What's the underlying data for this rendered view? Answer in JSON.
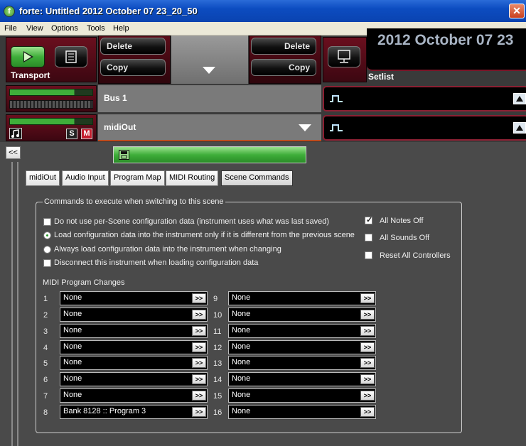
{
  "window": {
    "title": "forte: Untitled 2012 October 07 23_20_50",
    "close_glyph": "✕",
    "app_icon_letter": "f"
  },
  "menu": [
    {
      "label": "File",
      "name": "menu-file"
    },
    {
      "label": "View",
      "name": "menu-view"
    },
    {
      "label": "Options",
      "name": "menu-options"
    },
    {
      "label": "Tools",
      "name": "menu-tools"
    },
    {
      "label": "Help",
      "name": "menu-help"
    }
  ],
  "transport": {
    "label": "Transport"
  },
  "scene_buttons": {
    "delete_left": "Delete",
    "copy_left": "Copy",
    "delete_right": "Delete",
    "copy_right": "Copy"
  },
  "setlist": {
    "label": "Setlist",
    "banner": "2012 October 07 23"
  },
  "bus": {
    "name": "Bus 1"
  },
  "instrument": {
    "name": "midiOut",
    "solo": "S",
    "mute": "M"
  },
  "collapse": {
    "label": "<<"
  },
  "tabs": [
    "midiOut",
    "Audio Input",
    "Program Map",
    "MIDI Routing",
    "Scene Commands"
  ],
  "commands": {
    "group_title": "Commands to execute when switching to this scene",
    "options": [
      "Do not use per-Scene configuration data (instrument uses what was last saved)",
      "Load configuration data into the instrument only if it is different from the previous scene",
      "Always load configuration data into the instrument when changing",
      "Disconnect this instrument when loading configuration data"
    ],
    "right_options": [
      "All Notes Off",
      "All Sounds Off",
      "Reset All Controllers"
    ],
    "midi_title": "MIDI Program Changes",
    "button_label": ">>",
    "left_column": [
      {
        "num": "1",
        "value": "None"
      },
      {
        "num": "2",
        "value": "None"
      },
      {
        "num": "3",
        "value": "None"
      },
      {
        "num": "4",
        "value": "None"
      },
      {
        "num": "5",
        "value": "None"
      },
      {
        "num": "6",
        "value": "None"
      },
      {
        "num": "7",
        "value": "None"
      },
      {
        "num": "8",
        "value": "Bank 8128 :: Program 3"
      }
    ],
    "right_column": [
      {
        "num": "9",
        "value": "None"
      },
      {
        "num": "10",
        "value": "None"
      },
      {
        "num": "11",
        "value": "None"
      },
      {
        "num": "12",
        "value": "None"
      },
      {
        "num": "13",
        "value": "None"
      },
      {
        "num": "14",
        "value": "None"
      },
      {
        "num": "15",
        "value": "None"
      },
      {
        "num": "16",
        "value": "None"
      }
    ]
  }
}
